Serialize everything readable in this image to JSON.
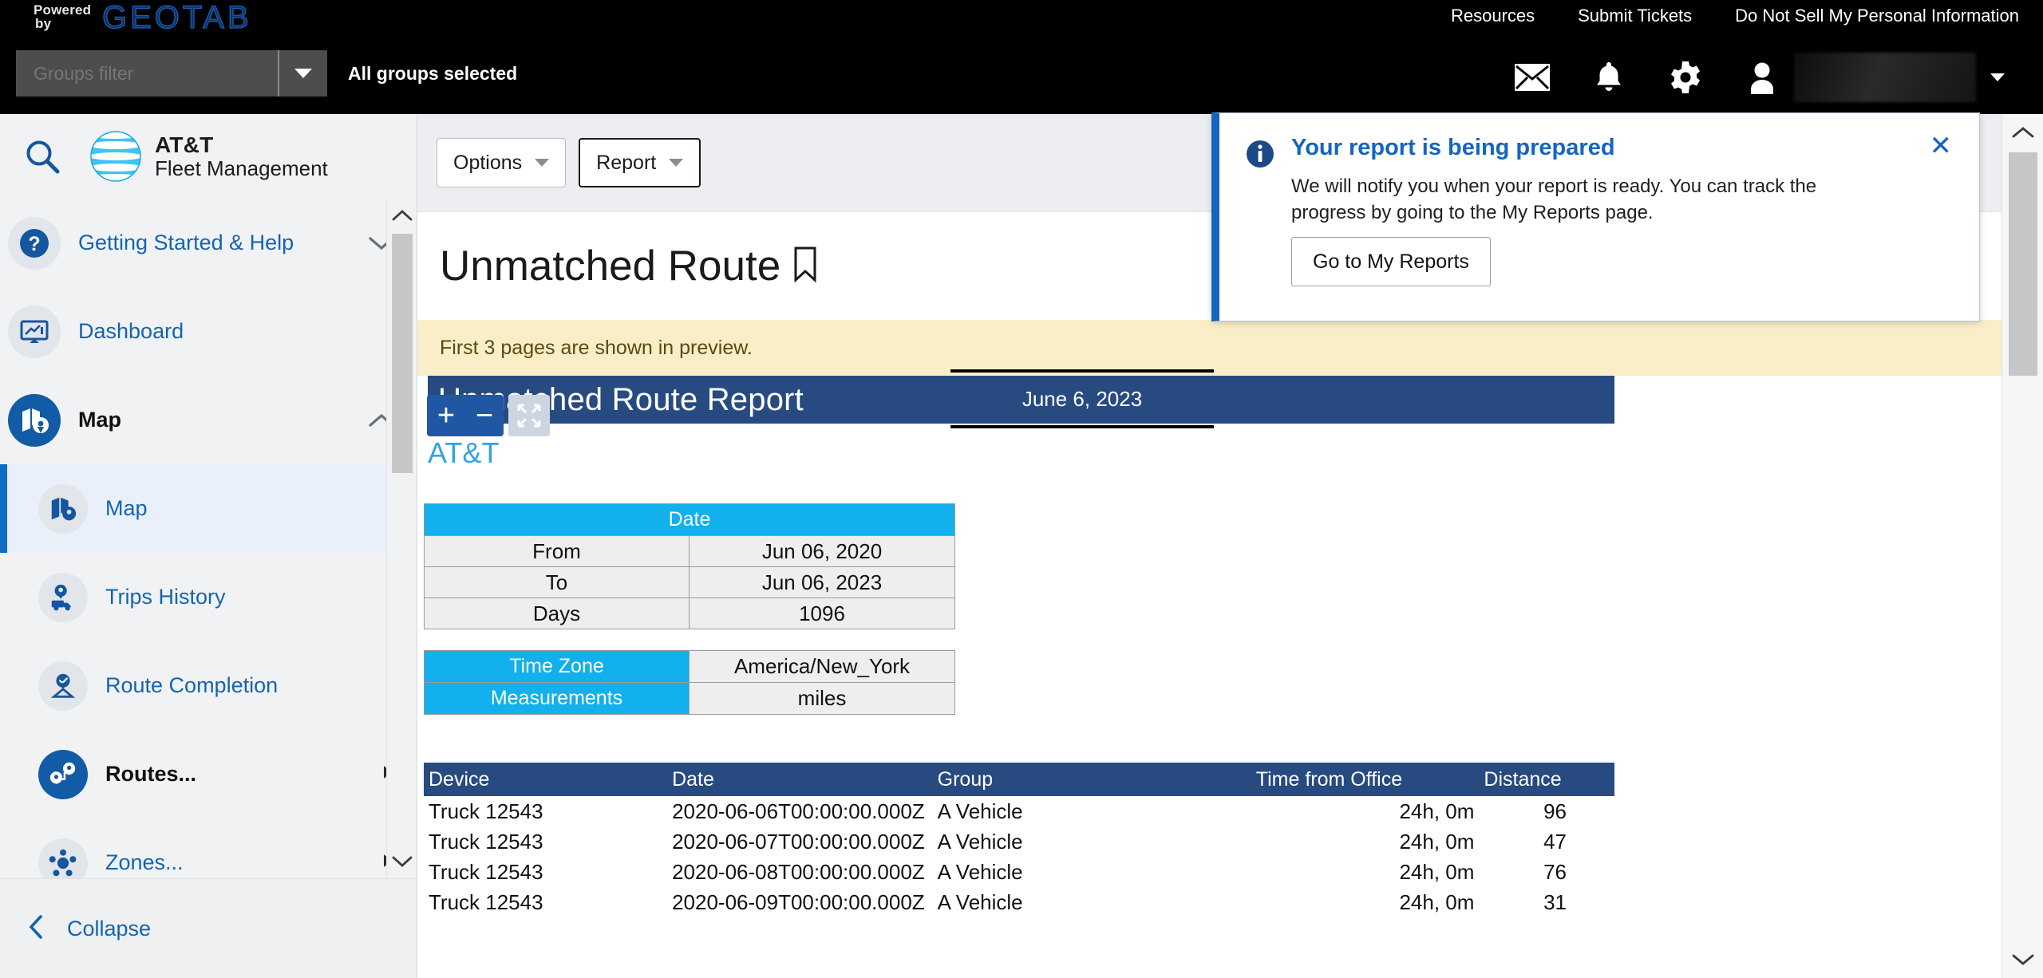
{
  "topbar": {
    "powered_line1": "Powered",
    "powered_line2": "by",
    "brand": "GEOTAB",
    "links": [
      "Resources",
      "Submit Tickets",
      "Do Not Sell My Personal Information"
    ],
    "groups_filter_placeholder": "Groups filter",
    "groups_filter_value": "",
    "all_groups_text": "All groups selected",
    "icons": [
      "mail-icon",
      "bell-icon",
      "gear-icon",
      "user-icon"
    ]
  },
  "sidebar": {
    "search_icon": "search-icon",
    "brand_line1": "AT&T",
    "brand_line2": "Fleet Management",
    "items": [
      {
        "label": "Getting Started & Help",
        "icon": "question-circle-icon",
        "chevron": "chevron-down",
        "level": "top",
        "state": "normal"
      },
      {
        "label": "Dashboard",
        "icon": "dashboard-icon",
        "chevron": "",
        "level": "top",
        "state": "normal"
      },
      {
        "label": "Map",
        "icon": "map-pin-icon",
        "chevron": "chevron-up",
        "level": "top",
        "state": "selected"
      },
      {
        "label": "Map",
        "icon": "map-pin-icon",
        "chevron": "",
        "level": "sub",
        "state": "active"
      },
      {
        "label": "Trips History",
        "icon": "truck-pin-icon",
        "chevron": "",
        "level": "sub",
        "state": "normal"
      },
      {
        "label": "Route Completion",
        "icon": "route-check-icon",
        "chevron": "",
        "level": "sub",
        "state": "normal"
      },
      {
        "label": "Routes...",
        "icon": "routes-icon",
        "chevron": "arrow-right",
        "level": "sub",
        "state": "selected"
      },
      {
        "label": "Zones...",
        "icon": "zones-icon",
        "chevron": "arrow-right",
        "level": "sub",
        "state": "normal"
      }
    ],
    "collapse_label": "Collapse",
    "collapse_icon": "chevron-left-icon"
  },
  "toolbar": {
    "options_label": "Options",
    "report_label": "Report"
  },
  "page": {
    "title": "Unmatched Route",
    "bookmark_icon": "bookmark-icon",
    "preview_notice": "First 3 pages are shown in preview.",
    "zoom_in": "+",
    "zoom_out": "−",
    "fit_icon": "shrink-fit-icon"
  },
  "report": {
    "title": "Unmatched Route Report",
    "date": "June 6, 2023",
    "company": "AT&T",
    "date_table": {
      "header": "Date",
      "rows": [
        {
          "label": "From",
          "value": "Jun 06, 2020"
        },
        {
          "label": "To",
          "value": "Jun 06, 2023"
        },
        {
          "label": "Days",
          "value": "1096"
        }
      ]
    },
    "settings_table": {
      "rows": [
        {
          "label": "Time Zone",
          "value": "America/New_York"
        },
        {
          "label": "Measurements",
          "value": "miles"
        }
      ]
    },
    "data_table": {
      "columns": [
        "Device",
        "Date",
        "Group",
        "Time from Office",
        "Distance"
      ],
      "rows": [
        [
          "Truck 12543",
          "2020-06-06T00:00:00.000Z",
          "A Vehicle",
          "24h, 0m",
          "96"
        ],
        [
          "Truck 12543",
          "2020-06-07T00:00:00.000Z",
          "A Vehicle",
          "24h, 0m",
          "47"
        ],
        [
          "Truck 12543",
          "2020-06-08T00:00:00.000Z",
          "A Vehicle",
          "24h, 0m",
          "76"
        ],
        [
          "Truck 12543",
          "2020-06-09T00:00:00.000Z",
          "A Vehicle",
          "24h, 0m",
          "31"
        ]
      ]
    }
  },
  "toast": {
    "icon": "info-circle-icon",
    "title": "Your report is being prepared",
    "body": "We will notify you when your report is ready. You can track the progress by going to the My Reports page.",
    "button_label": "Go to My Reports",
    "close_label": "✕"
  },
  "colors": {
    "brand_blue": "#1565c0",
    "report_band": "#274a81",
    "table_header_cyan": "#12b0ec",
    "banner_yellow": "#faeec9",
    "att_cyan": "#31a3e0"
  }
}
